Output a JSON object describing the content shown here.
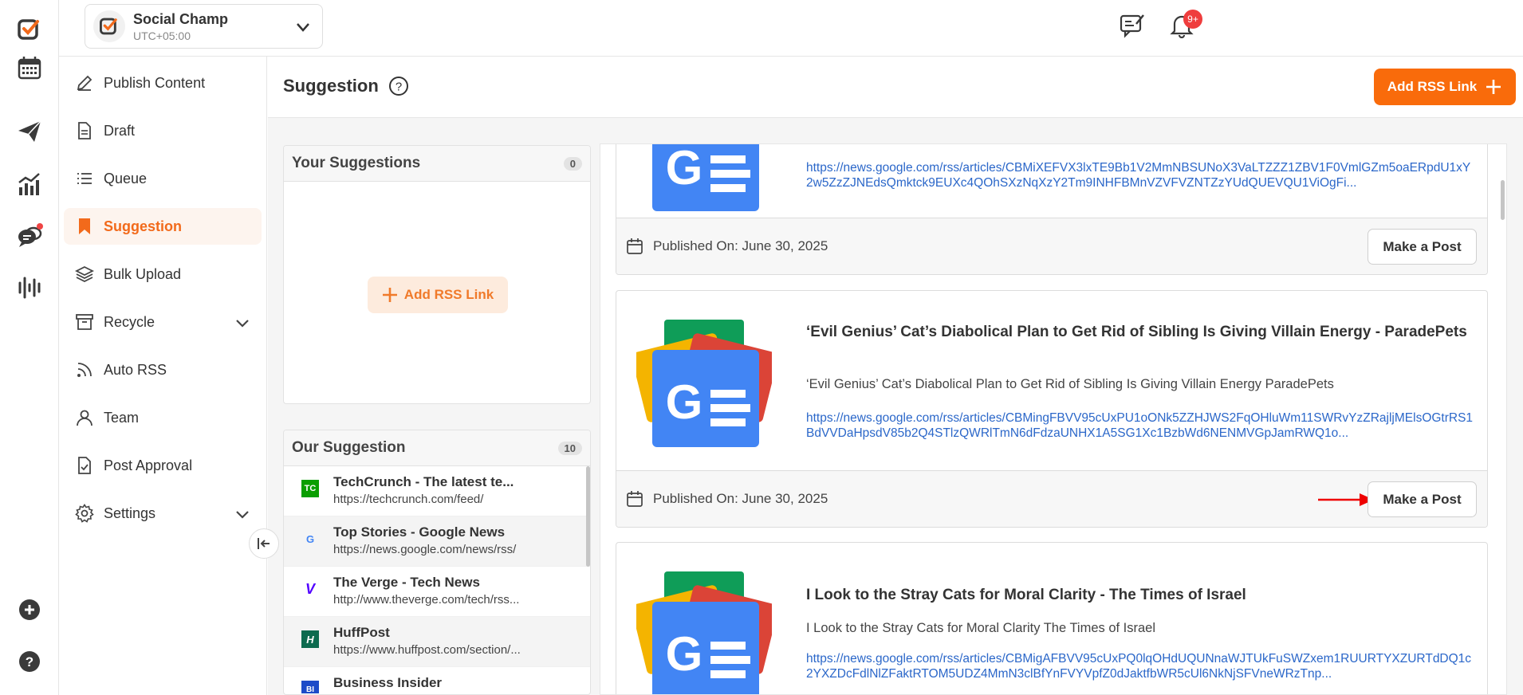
{
  "header": {
    "account_name": "Social Champ",
    "timezone": "UTC+05:00",
    "notification_badge": "9+"
  },
  "sidebar": {
    "items": [
      {
        "label": "Publish Content",
        "icon": "pencil-icon"
      },
      {
        "label": "Draft",
        "icon": "document-icon"
      },
      {
        "label": "Queue",
        "icon": "list-icon"
      },
      {
        "label": "Suggestion",
        "icon": "bookmark-icon",
        "active": true
      },
      {
        "label": "Bulk Upload",
        "icon": "layers-icon"
      },
      {
        "label": "Recycle",
        "icon": "archive-icon",
        "expandable": true
      },
      {
        "label": "Auto RSS",
        "icon": "rss-icon"
      },
      {
        "label": "Team",
        "icon": "user-icon"
      },
      {
        "label": "Post Approval",
        "icon": "file-check-icon"
      },
      {
        "label": "Settings",
        "icon": "gear-icon",
        "expandable": true
      }
    ]
  },
  "main": {
    "title": "Suggestion",
    "add_rss_label": "Add RSS Link"
  },
  "your_suggestions": {
    "title": "Your Suggestions",
    "count": "0",
    "add_rss_label": "Add RSS Link"
  },
  "our_suggestion": {
    "title": "Our Suggestion",
    "count": "10",
    "feeds": [
      {
        "name": "TechCrunch - The latest te...",
        "url": "https://techcrunch.com/feed/",
        "logo": "TC",
        "logo_color": "#0a9e01"
      },
      {
        "name": "Top Stories - Google News",
        "url": "https://news.google.com/news/rss/",
        "logo": "G",
        "logo_color": "#4285f4"
      },
      {
        "name": "The Verge - Tech News",
        "url": "http://www.theverge.com/tech/rss...",
        "logo": "V",
        "logo_color": "#5200ff"
      },
      {
        "name": "HuffPost",
        "url": "https://www.huffpost.com/section/...",
        "logo": "H",
        "logo_color": "#0d6b4f"
      },
      {
        "name": "Business Insider",
        "url": "",
        "logo": "BI",
        "logo_color": "#1d4bc8"
      }
    ]
  },
  "articles": [
    {
      "title": "",
      "description": "",
      "link": "https://news.google.com/rss/articles/CBMiXEFVX3lxTE9Bb1V2MmNBSUNoX3VaLTZZZ1ZBV1F0VmlGZm5oaERpdU1xY2w5ZzZJNEdsQmktck9EUXc4QOhSXzNqXzY2Tm9INHFBMnVZVFVZNTZzYUdQUEVQU1ViOgFi...",
      "published": "Published On: June 30, 2025",
      "action": "Make a Post"
    },
    {
      "title": "‘Evil Genius’ Cat’s Diabolical Plan to Get Rid of Sibling Is Giving Villain Energy - ParadePets",
      "description": "‘Evil Genius’ Cat’s Diabolical Plan to Get Rid of Sibling Is Giving Villain Energy ParadePets",
      "link": "https://news.google.com/rss/articles/CBMingFBVV95cUxPU1oONk5ZZHJWS2FqOHluWm11SWRvYzZRajljMElsOGtrRS1BdVVDaHpsdV85b2Q4STlzQWRlTmN6dFdzaUNHX1A5SG1Xc1BzbWd6NENMVGpJamRWQ1o...",
      "published": "Published On: June 30, 2025",
      "action": "Make a Post"
    },
    {
      "title": "I Look to the Stray Cats for Moral Clarity - The Times of Israel",
      "description": "I Look to the Stray Cats for Moral Clarity The Times of Israel",
      "link": "https://news.google.com/rss/articles/CBMigAFBVV95cUxPQ0lqOHdUQUNnaWJTUkFuSWZxem1RUURTYXZURTdDQ1c2YXZDcFdlNlZFaktRTOM5UDZ4MmN3clBfYnFVYVpfZ0dJaktfbWR5cUl6NkNjSFVneWRzTnp...",
      "published": "",
      "action": ""
    }
  ],
  "colors": {
    "brand_orange": "#f96b0b",
    "link_blue": "#2b67c9",
    "badge_red": "#ef3d3d"
  }
}
